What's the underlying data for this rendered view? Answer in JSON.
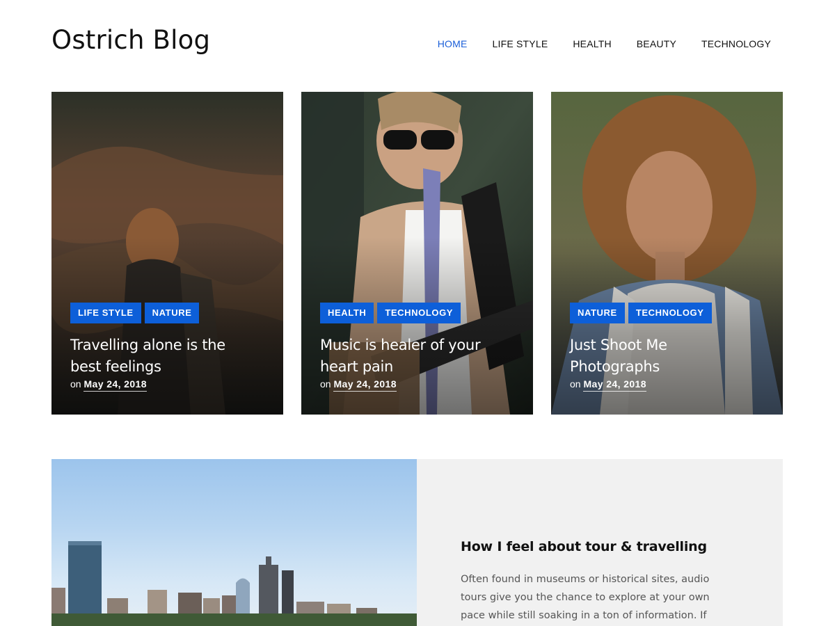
{
  "site": {
    "title": "Ostrich Blog"
  },
  "nav": {
    "items": [
      {
        "label": "HOME",
        "active": true
      },
      {
        "label": "LIFE STYLE",
        "active": false
      },
      {
        "label": "HEALTH",
        "active": false
      },
      {
        "label": "BEAUTY",
        "active": false
      },
      {
        "label": "TECHNOLOGY",
        "active": false
      }
    ]
  },
  "featured": [
    {
      "tags": [
        "LIFE STYLE",
        "NATURE"
      ],
      "title_line1": "Travelling alone is the",
      "title_line2": "best feelings",
      "meta_prefix": "on",
      "date": "May 24, 2018"
    },
    {
      "tags": [
        "HEALTH",
        "TECHNOLOGY"
      ],
      "title_line1": "Music is healer of your",
      "title_line2": "heart pain",
      "meta_prefix": "on",
      "date": "May 24, 2018"
    },
    {
      "tags": [
        "NATURE",
        "TECHNOLOGY"
      ],
      "title_line1": "Just Shoot Me",
      "title_line2": "Photographs",
      "meta_prefix": "on",
      "date": "May 24, 2018"
    }
  ],
  "post": {
    "title": "How I feel about tour & travelling",
    "excerpt_line1": "Often found in museums or historical sites, audio",
    "excerpt_line2": "tours give you the chance to explore at your own",
    "excerpt_line3": "pace while still soaking in a ton of information. If"
  },
  "colors": {
    "accent": "#0d5fd9",
    "nav_active": "#1a5ed8",
    "panel_bg": "#f1f1f1"
  }
}
